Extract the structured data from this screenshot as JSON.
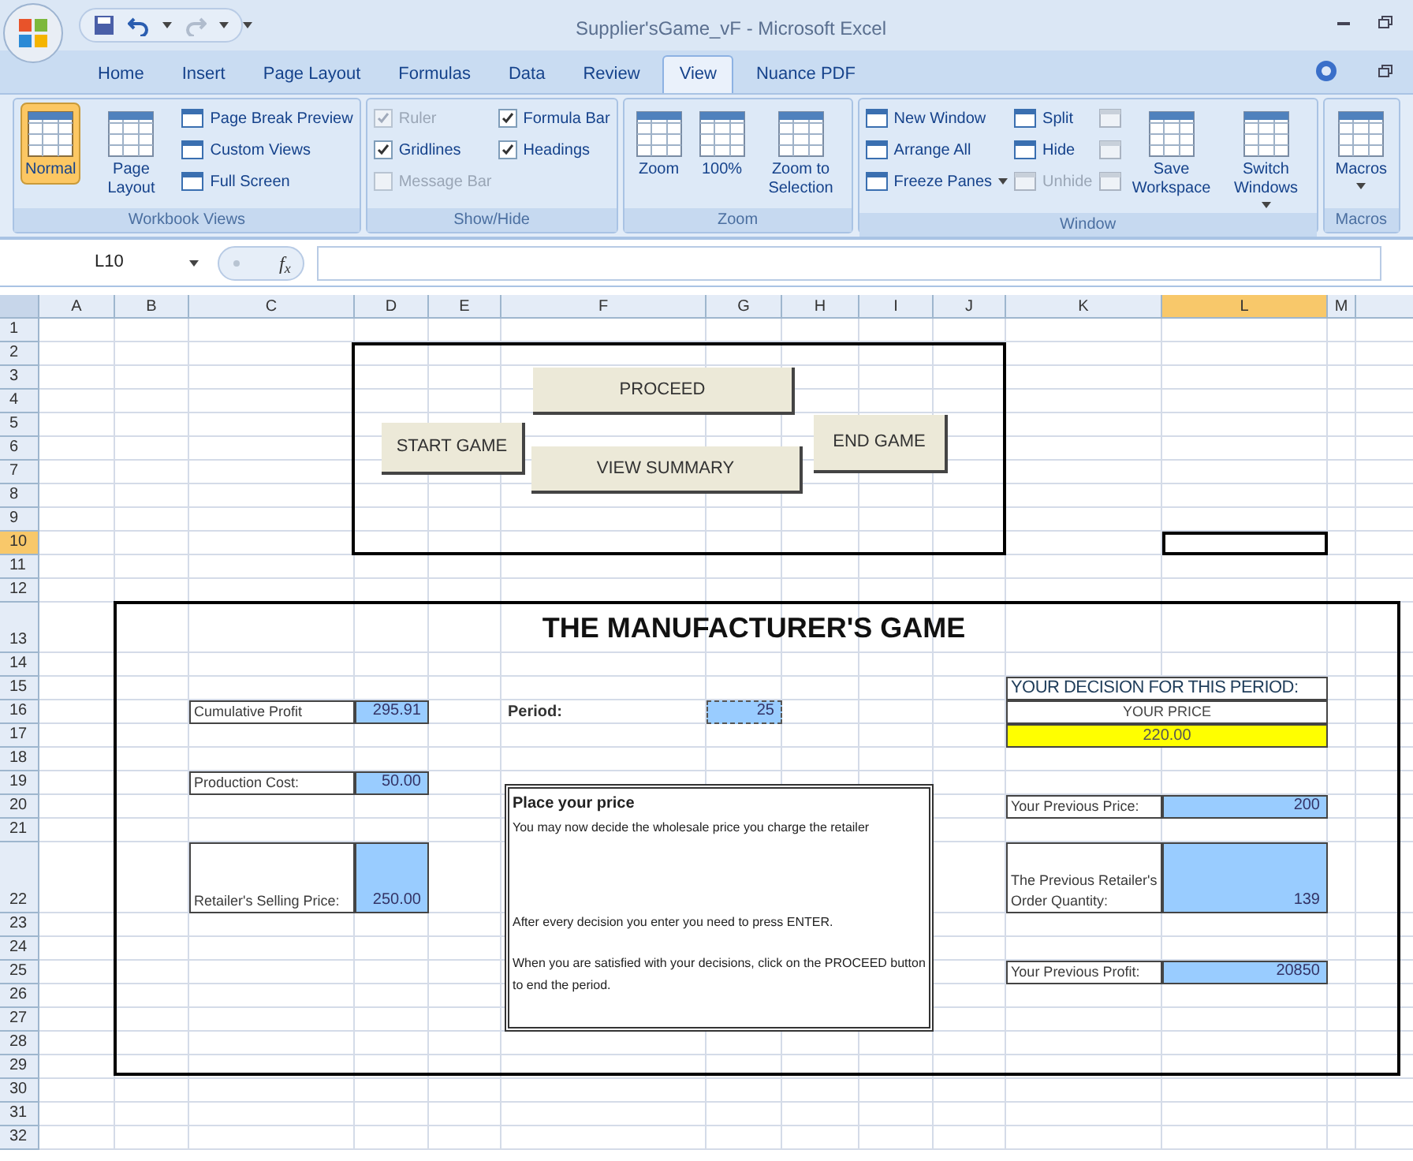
{
  "window": {
    "title": "Supplier'sGame_vF - Microsoft Excel"
  },
  "ribbon": {
    "tabs": [
      {
        "label": "Home",
        "selected": false
      },
      {
        "label": "Insert",
        "selected": false
      },
      {
        "label": "Page Layout",
        "selected": false
      },
      {
        "label": "Formulas",
        "selected": false
      },
      {
        "label": "Data",
        "selected": false
      },
      {
        "label": "Review",
        "selected": false
      },
      {
        "label": "View",
        "selected": true
      },
      {
        "label": "Nuance PDF",
        "selected": false
      }
    ],
    "groups": [
      {
        "label": "Workbook Views",
        "items": [
          {
            "kind": "large",
            "label": "Normal",
            "selected": true
          },
          {
            "kind": "large",
            "label": "Page Layout",
            "selected": false
          },
          {
            "kind": "small",
            "label": "Page Break Preview",
            "disabled": false
          },
          {
            "kind": "small",
            "label": "Custom Views",
            "disabled": false
          },
          {
            "kind": "small",
            "label": "Full Screen",
            "disabled": false
          }
        ]
      },
      {
        "label": "Show/Hide",
        "items": [
          {
            "kind": "check",
            "label": "Ruler",
            "checked": true,
            "disabled": true
          },
          {
            "kind": "check",
            "label": "Gridlines",
            "checked": true,
            "disabled": false
          },
          {
            "kind": "check",
            "label": "Message Bar",
            "checked": false,
            "disabled": true
          },
          {
            "kind": "check",
            "label": "Formula Bar",
            "checked": true,
            "disabled": false
          },
          {
            "kind": "check",
            "label": "Headings",
            "checked": true,
            "disabled": false
          }
        ]
      },
      {
        "label": "Zoom",
        "items": [
          {
            "kind": "large",
            "label": "Zoom"
          },
          {
            "kind": "large",
            "label": "100%"
          },
          {
            "kind": "large",
            "label": "Zoom to Selection"
          }
        ]
      },
      {
        "label": "Window",
        "items": [
          {
            "kind": "small",
            "label": "New Window",
            "disabled": false
          },
          {
            "kind": "small",
            "label": "Arrange All",
            "disabled": false
          },
          {
            "kind": "small",
            "label": "Freeze Panes",
            "disabled": false,
            "dropdown": true
          },
          {
            "kind": "small",
            "label": "Split",
            "disabled": false
          },
          {
            "kind": "small",
            "label": "Hide",
            "disabled": false
          },
          {
            "kind": "small",
            "label": "Unhide",
            "disabled": true
          },
          {
            "kind": "icon",
            "disabled": true
          },
          {
            "kind": "icon",
            "disabled": true
          },
          {
            "kind": "icon",
            "disabled": true
          },
          {
            "kind": "large",
            "label": "Save Workspace"
          },
          {
            "kind": "large",
            "label": "Switch Windows",
            "dropdown": true
          }
        ]
      },
      {
        "label": "Macros",
        "items": [
          {
            "kind": "large",
            "label": "Macros",
            "dropdown": true
          }
        ]
      }
    ]
  },
  "formula_bar": {
    "name_box": "L10",
    "function_label": "f$_{x}$"
  },
  "sheet": {
    "columns": [
      {
        "label": "A",
        "selected": false
      },
      {
        "label": "B",
        "selected": false
      },
      {
        "label": "C",
        "selected": false
      },
      {
        "label": "D",
        "selected": false
      },
      {
        "label": "E",
        "selected": false
      },
      {
        "label": "F",
        "selected": false
      },
      {
        "label": "G",
        "selected": false
      },
      {
        "label": "H",
        "selected": false
      },
      {
        "label": "I",
        "selected": false
      },
      {
        "label": "J",
        "selected": false
      },
      {
        "label": "K",
        "selected": false
      },
      {
        "label": "L",
        "selected": true
      },
      {
        "label": "M",
        "selected": false
      }
    ],
    "rows": [
      {
        "label": "1",
        "selected": false
      },
      {
        "label": "2",
        "selected": false
      },
      {
        "label": "3",
        "selected": false
      },
      {
        "label": "4",
        "selected": false
      },
      {
        "label": "5",
        "selected": false
      },
      {
        "label": "6",
        "selected": false
      },
      {
        "label": "7",
        "selected": false
      },
      {
        "label": "8",
        "selected": false
      },
      {
        "label": "9",
        "selected": false
      },
      {
        "label": "10",
        "selected": true
      },
      {
        "label": "11",
        "selected": false
      },
      {
        "label": "12",
        "selected": false
      },
      {
        "label": "13",
        "selected": false
      },
      {
        "label": "14",
        "selected": false
      },
      {
        "label": "15",
        "selected": false
      },
      {
        "label": "16",
        "selected": false
      },
      {
        "label": "17",
        "selected": false
      },
      {
        "label": "18",
        "selected": false
      },
      {
        "label": "19",
        "selected": false
      },
      {
        "label": "20",
        "selected": false
      },
      {
        "label": "21",
        "selected": false
      },
      {
        "label": "22",
        "selected": false
      },
      {
        "label": "23",
        "selected": false
      },
      {
        "label": "24",
        "selected": false
      },
      {
        "label": "25",
        "selected": false
      },
      {
        "label": "26",
        "selected": false
      },
      {
        "label": "27",
        "selected": false
      },
      {
        "label": "28",
        "selected": false
      },
      {
        "label": "29",
        "selected": false
      },
      {
        "label": "30",
        "selected": false
      },
      {
        "label": "31",
        "selected": false
      },
      {
        "label": "32",
        "selected": false
      }
    ],
    "cells": [
      {
        "kind": "title",
        "text": "THE MANUFACTURER'S GAME"
      },
      {
        "kind": "heading",
        "text": "YOUR DECISION FOR THIS PERIOD:"
      },
      {
        "kind": "label",
        "text": "Cumulative Profit"
      },
      {
        "kind": "value",
        "text": "295.91"
      },
      {
        "kind": "bold",
        "text": "Period:"
      },
      {
        "kind": "marquee",
        "text": "25"
      },
      {
        "kind": "caption",
        "text": "YOUR PRICE"
      },
      {
        "kind": "input",
        "text": "220.00"
      },
      {
        "kind": "label",
        "text": "Production Cost:"
      },
      {
        "kind": "value",
        "text": "50.00"
      },
      {
        "kind": "label",
        "text": "Your Previous Price:"
      },
      {
        "kind": "value",
        "text": "200"
      },
      {
        "kind": "label",
        "text": "Retailer's Selling Price:"
      },
      {
        "kind": "value",
        "text": "250.00"
      },
      {
        "kind": "label",
        "text": "The Previous Retailer's Order Quantity:"
      },
      {
        "kind": "value",
        "text": "139"
      },
      {
        "kind": "label",
        "text": "Your Previous Profit:"
      },
      {
        "kind": "value",
        "text": "20850"
      }
    ],
    "buttons": [
      {
        "label": "START GAME"
      },
      {
        "label": "PROCEED"
      },
      {
        "label": "VIEW SUMMARY"
      },
      {
        "label": "END GAME"
      }
    ],
    "text_box": {
      "title": "Place your price",
      "paragraphs": [
        "You may now decide the wholesale price you charge the retailer",
        "After every decision you enter you need to press ENTER.",
        "When you are satisfied with your decisions, click on the PROCEED button to end the period."
      ]
    }
  }
}
